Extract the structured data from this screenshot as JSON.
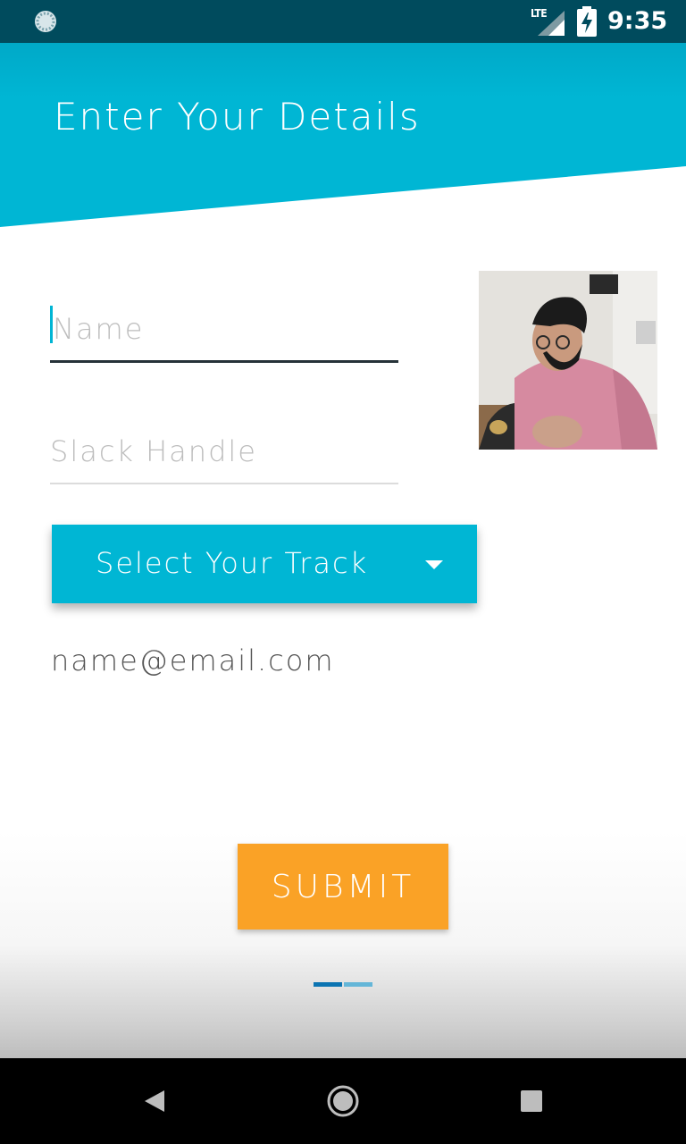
{
  "status_bar": {
    "network_label": "LTE",
    "time": "9:35",
    "icons": [
      "sync-icon",
      "signal-icon",
      "battery-charging-icon"
    ]
  },
  "header": {
    "title": "Enter Your Details",
    "color": "#00b5d4"
  },
  "form": {
    "name_placeholder": "Name",
    "name_value": "",
    "slack_placeholder": "Slack Handle",
    "slack_value": "",
    "track_button_label": "Select Your Track",
    "email_text": "name@email.com",
    "submit_label": "SUBMIT"
  },
  "colors": {
    "accent": "#00b6d4",
    "submit": "#faa226",
    "status_bar": "#004b5d"
  },
  "pager": {
    "pages": 2,
    "active_index": 0
  },
  "nav_bar": {
    "icons": [
      "back-icon",
      "home-icon",
      "recents-icon"
    ]
  }
}
